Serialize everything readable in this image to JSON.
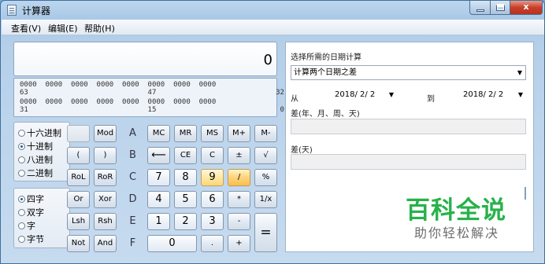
{
  "window": {
    "title": "计算器",
    "min_label": "",
    "max_label": "",
    "close_label": "x"
  },
  "menu": [
    "查看(V)",
    "编辑(E)",
    "帮助(H)"
  ],
  "display": {
    "value": "0"
  },
  "bits": {
    "row1": "0000  0000  0000  0000  0000  0000  0000  0000",
    "row1_idx": "63                            47                            32",
    "row2": "0000  0000  0000  0000  0000  0000  0000  0000",
    "row2_idx": "31                            15                             0"
  },
  "base_radios": [
    {
      "label": "十六进制",
      "selected": false
    },
    {
      "label": "十进制",
      "selected": true
    },
    {
      "label": "八进制",
      "selected": false
    },
    {
      "label": "二进制",
      "selected": false
    }
  ],
  "word_radios": [
    {
      "label": "四字",
      "selected": true
    },
    {
      "label": "双字",
      "selected": false
    },
    {
      "label": "字",
      "selected": false
    },
    {
      "label": "字节",
      "selected": false
    }
  ],
  "keys": {
    "blank": "",
    "mod": "Mod",
    "A": "A",
    "mc": "MC",
    "mr": "MR",
    "ms": "MS",
    "mplus": "M+",
    "mminus": "M-",
    "lparen": "(",
    "rparen": ")",
    "B": "B",
    "back": "⟵",
    "ce": "CE",
    "c": "C",
    "pm": "±",
    "sqrt": "√",
    "rol": "RoL",
    "ror": "RoR",
    "C": "C",
    "k7": "7",
    "k8": "8",
    "k9": "9",
    "div": "/",
    "pct": "%",
    "or": "Or",
    "xor": "Xor",
    "D": "D",
    "k4": "4",
    "k5": "5",
    "k6": "6",
    "mul": "*",
    "inv": "1/x",
    "lsh": "Lsh",
    "rsh": "Rsh",
    "E": "E",
    "k1": "1",
    "k2": "2",
    "k3": "3",
    "sub": "-",
    "eq": "=",
    "not": "Not",
    "and": "And",
    "F": "F",
    "k0": "0",
    "dot": ".",
    "add": "+"
  },
  "date_panel": {
    "heading": "选择所需的日期计算",
    "mode": "计算两个日期之差",
    "from_label": "从",
    "from_date": "2018/ 2/ 2",
    "to_label": "到",
    "to_date": "2018/ 2/ 2",
    "diff_ymwd_label": "差(年、月、周、天)",
    "diff_days_label": "差(天)"
  },
  "watermark": {
    "brand": "百科全说",
    "slogan": "助你轻松解决"
  }
}
